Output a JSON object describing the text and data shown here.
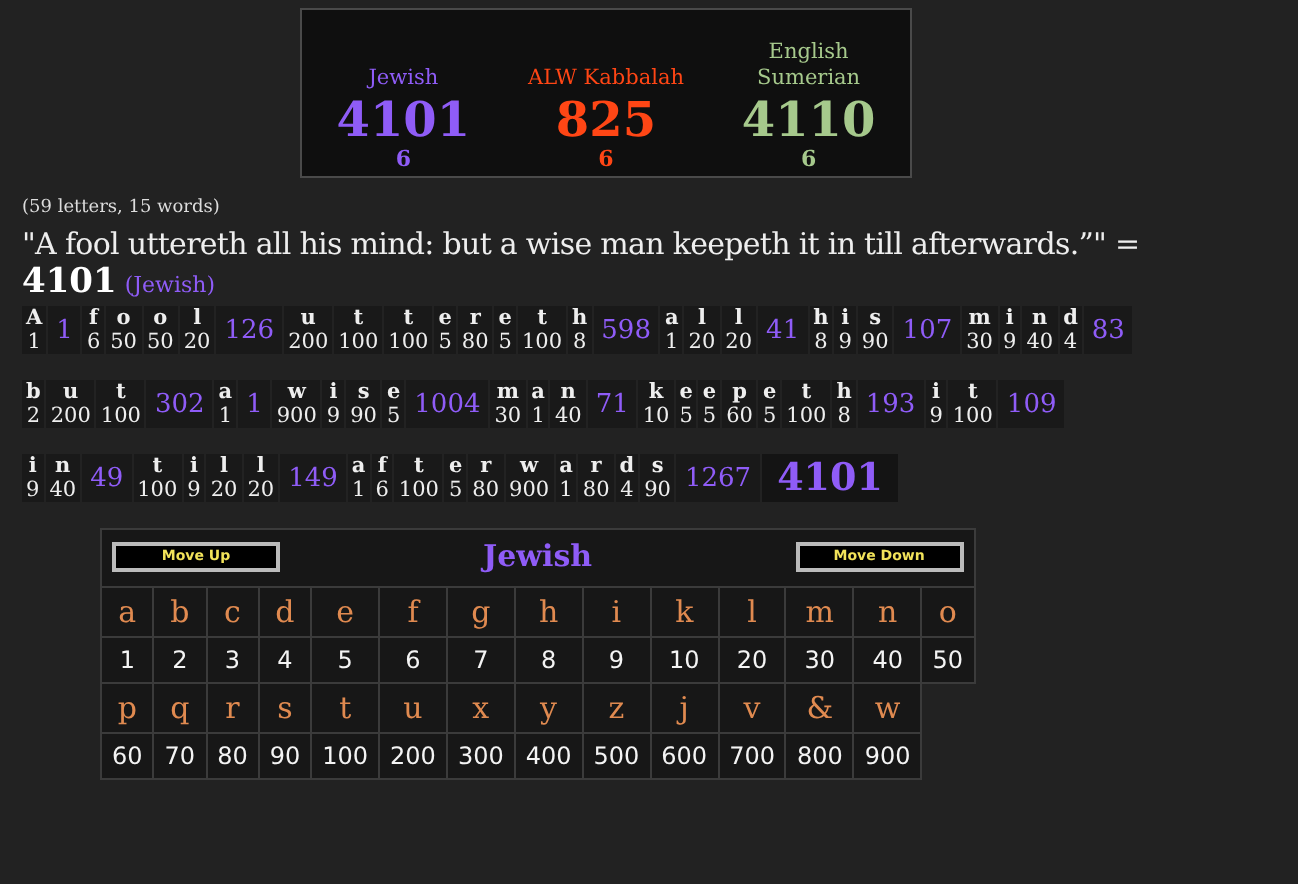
{
  "summary": {
    "ciphers": [
      {
        "name": "Jewish",
        "value": "4101",
        "count": "6",
        "color": "#8f5cf7"
      },
      {
        "name": "ALW Kabbalah",
        "value": "825",
        "count": "6",
        "color": "#ff4615"
      },
      {
        "name": "English Sumerian",
        "value": "4110",
        "count": "6",
        "color": "#a6c98c"
      }
    ]
  },
  "stats": "(59 letters, 15 words)",
  "phrase": "\"A fool uttereth all his mind: but a wise man keepeth it in till afterwards.”\" =",
  "total": "4101",
  "total_cipher": "(Jewish)",
  "breakdown": [
    {
      "words": [
        {
          "letters": [
            [
              "A",
              "1"
            ]
          ],
          "total": "1"
        },
        {
          "letters": [
            [
              "f",
              "6"
            ],
            [
              "o",
              "50"
            ],
            [
              "o",
              "50"
            ],
            [
              "l",
              "20"
            ]
          ],
          "total": "126"
        },
        {
          "letters": [
            [
              "u",
              "200"
            ],
            [
              "t",
              "100"
            ],
            [
              "t",
              "100"
            ],
            [
              "e",
              "5"
            ],
            [
              "r",
              "80"
            ],
            [
              "e",
              "5"
            ],
            [
              "t",
              "100"
            ],
            [
              "h",
              "8"
            ]
          ],
          "total": "598"
        },
        {
          "letters": [
            [
              "a",
              "1"
            ],
            [
              "l",
              "20"
            ],
            [
              "l",
              "20"
            ]
          ],
          "total": "41"
        },
        {
          "letters": [
            [
              "h",
              "8"
            ],
            [
              "i",
              "9"
            ],
            [
              "s",
              "90"
            ]
          ],
          "total": "107"
        },
        {
          "letters": [
            [
              "m",
              "30"
            ],
            [
              "i",
              "9"
            ],
            [
              "n",
              "40"
            ],
            [
              "d",
              "4"
            ]
          ],
          "total": "83"
        }
      ]
    },
    {
      "words": [
        {
          "letters": [
            [
              "b",
              "2"
            ],
            [
              "u",
              "200"
            ],
            [
              "t",
              "100"
            ]
          ],
          "total": "302"
        },
        {
          "letters": [
            [
              "a",
              "1"
            ]
          ],
          "total": "1"
        },
        {
          "letters": [
            [
              "w",
              "900"
            ],
            [
              "i",
              "9"
            ],
            [
              "s",
              "90"
            ],
            [
              "e",
              "5"
            ]
          ],
          "total": "1004"
        },
        {
          "letters": [
            [
              "m",
              "30"
            ],
            [
              "a",
              "1"
            ],
            [
              "n",
              "40"
            ]
          ],
          "total": "71"
        },
        {
          "letters": [
            [
              "k",
              "10"
            ],
            [
              "e",
              "5"
            ],
            [
              "e",
              "5"
            ],
            [
              "p",
              "60"
            ],
            [
              "e",
              "5"
            ],
            [
              "t",
              "100"
            ],
            [
              "h",
              "8"
            ]
          ],
          "total": "193"
        },
        {
          "letters": [
            [
              "i",
              "9"
            ],
            [
              "t",
              "100"
            ]
          ],
          "total": "109"
        }
      ]
    },
    {
      "words": [
        {
          "letters": [
            [
              "i",
              "9"
            ],
            [
              "n",
              "40"
            ]
          ],
          "total": "49"
        },
        {
          "letters": [
            [
              "t",
              "100"
            ],
            [
              "i",
              "9"
            ],
            [
              "l",
              "20"
            ],
            [
              "l",
              "20"
            ]
          ],
          "total": "149"
        },
        {
          "letters": [
            [
              "a",
              "1"
            ],
            [
              "f",
              "6"
            ],
            [
              "t",
              "100"
            ],
            [
              "e",
              "5"
            ],
            [
              "r",
              "80"
            ],
            [
              "w",
              "900"
            ],
            [
              "a",
              "1"
            ],
            [
              "r",
              "80"
            ],
            [
              "d",
              "4"
            ],
            [
              "s",
              "90"
            ]
          ],
          "total": "1267"
        }
      ],
      "grand_total": "4101"
    }
  ],
  "cipher_table": {
    "title": "Jewish",
    "move_up": "Move Up",
    "move_down": "Move Down",
    "rows": [
      {
        "letters": [
          "a",
          "b",
          "c",
          "d",
          "e",
          "f",
          "g",
          "h",
          "i",
          "k",
          "l",
          "m",
          "n",
          "o"
        ],
        "values": [
          "1",
          "2",
          "3",
          "4",
          "5",
          "6",
          "7",
          "8",
          "9",
          "10",
          "20",
          "30",
          "40",
          "50"
        ]
      },
      {
        "letters": [
          "p",
          "q",
          "r",
          "s",
          "t",
          "u",
          "x",
          "y",
          "z",
          "j",
          "v",
          "&",
          "w"
        ],
        "values": [
          "60",
          "70",
          "80",
          "90",
          "100",
          "200",
          "300",
          "400",
          "500",
          "600",
          "700",
          "800",
          "900"
        ]
      }
    ]
  }
}
